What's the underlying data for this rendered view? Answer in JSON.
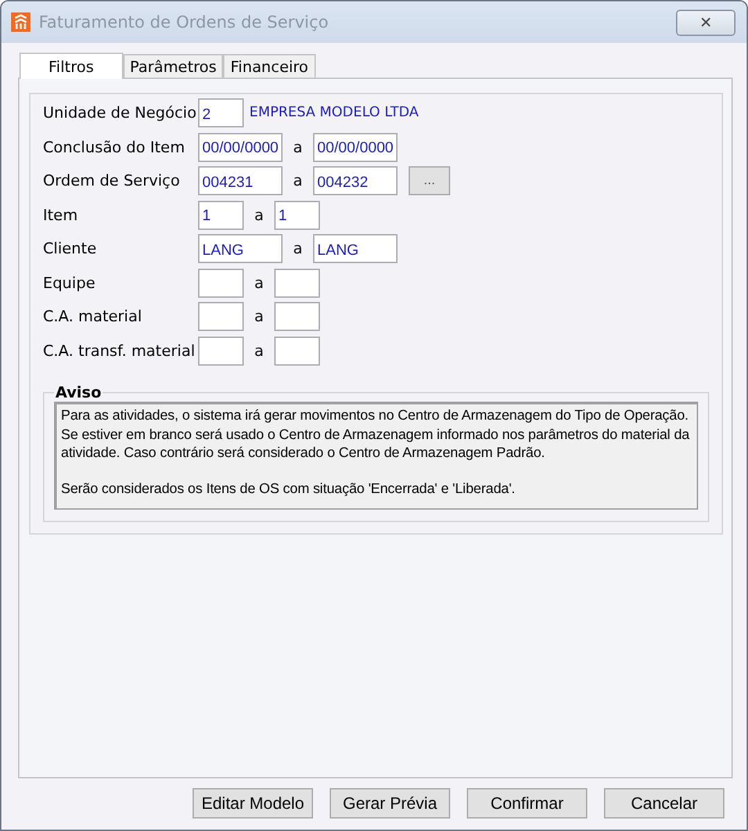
{
  "window": {
    "title": "Faturamento de Ordens de Serviço",
    "close": "✕"
  },
  "tabs": [
    {
      "label": "Filtros",
      "selected": true
    },
    {
      "label": "Parâmetros",
      "selected": false
    },
    {
      "label": "Financeiro",
      "selected": false
    }
  ],
  "filters": [
    {
      "kind": "single",
      "label": "Unidade de Negócio",
      "value": "2",
      "description": "EMPRESA MODELO LTDA"
    },
    {
      "kind": "range",
      "label": "Conclusão do Item",
      "from": "00/00/0000",
      "separator": "a",
      "to": "00/00/0000"
    },
    {
      "kind": "range",
      "label": "Ordem de Serviço",
      "from": "004231",
      "separator": "a",
      "to": "004232",
      "button": "..."
    },
    {
      "kind": "range",
      "label": "Item",
      "from": "1",
      "separator": "a",
      "to": "1"
    },
    {
      "kind": "range",
      "label": "Cliente",
      "from": "LANG",
      "separator": "a",
      "to": "LANG"
    },
    {
      "kind": "range",
      "label": "Equipe",
      "separator": "a"
    },
    {
      "kind": "range",
      "label": "C.A. material",
      "separator": "a"
    },
    {
      "kind": "range",
      "label": "C.A. transf. material",
      "separator": "a"
    }
  ],
  "notice": {
    "title": "Aviso",
    "paragraphs": [
      "Para as atividades, o sistema irá gerar movimentos no Centro de Armazenagem do Tipo de Operação. Se estiver em branco será usado o Centro de Armazenagem informado nos parâmetros do material da atividade. Caso contrário será considerado o Centro de Armazenagem Padrão.",
      "Serão considerados os Itens de OS com situação 'Encerrada' e 'Liberada'."
    ]
  },
  "buttons": [
    "Editar Modelo",
    "Gerar Prévia",
    "Confirmar",
    "Cancelar"
  ]
}
